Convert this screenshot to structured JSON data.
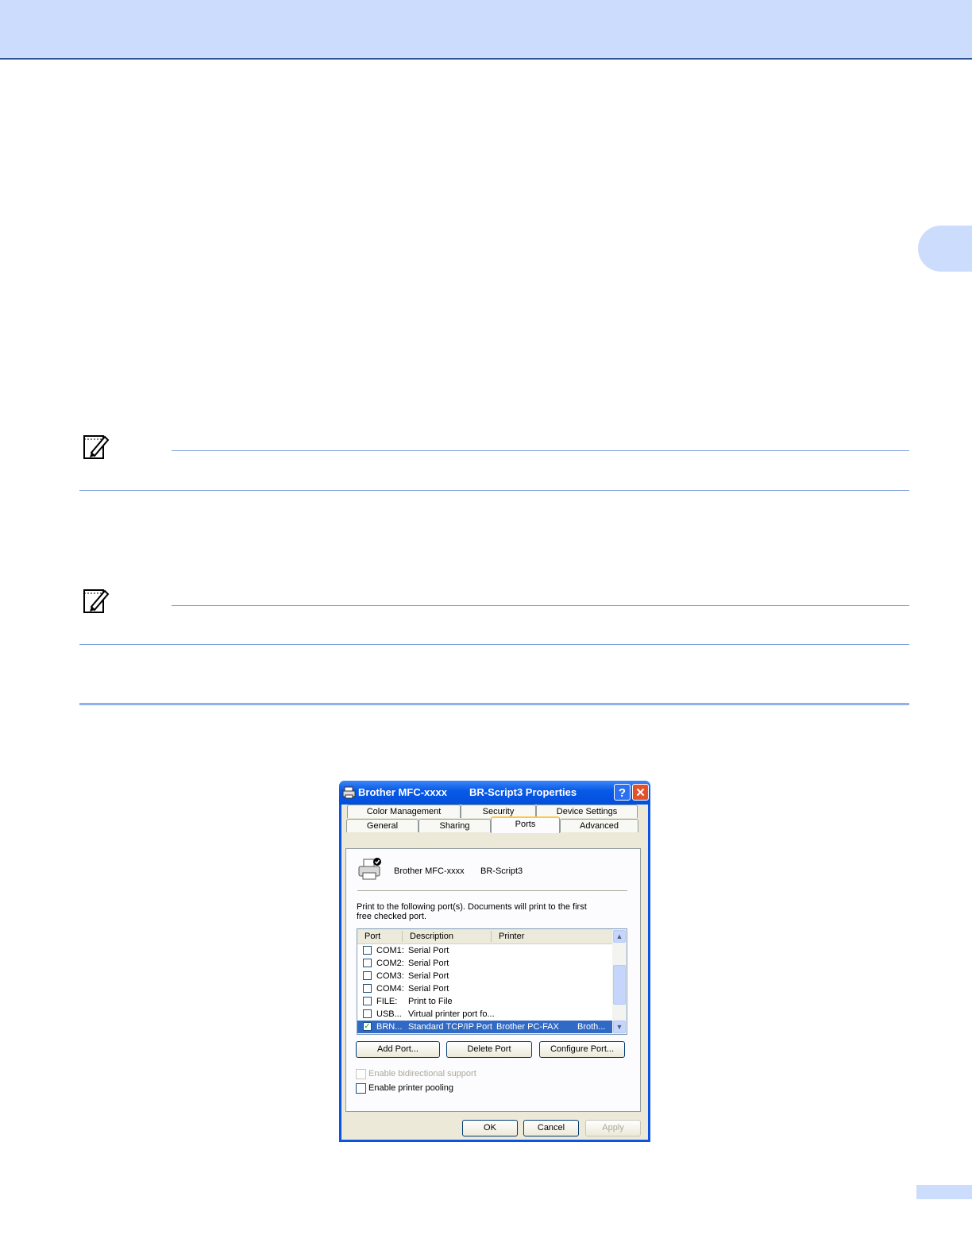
{
  "dialog": {
    "title_left": "Brother MFC-xxxx",
    "title_right": "BR-Script3 Properties",
    "help_symbol": "?",
    "close_symbol": "✕",
    "tabs_row1": [
      "Color Management",
      "Security",
      "Device Settings"
    ],
    "tabs_row2": [
      "General",
      "Sharing",
      "Ports",
      "Advanced"
    ],
    "active_tab": "Ports",
    "printer_name": "Brother MFC-xxxx",
    "printer_driver": "BR-Script3",
    "instruction": "Print to the following port(s). Documents will print to the first free checked port.",
    "columns": [
      "Port",
      "Description",
      "Printer"
    ],
    "ports": [
      {
        "port": "COM1:",
        "description": "Serial Port",
        "printer": "",
        "printer2": "",
        "checked": false
      },
      {
        "port": "COM2:",
        "description": "Serial Port",
        "printer": "",
        "printer2": "",
        "checked": false
      },
      {
        "port": "COM3:",
        "description": "Serial Port",
        "printer": "",
        "printer2": "",
        "checked": false
      },
      {
        "port": "COM4:",
        "description": "Serial Port",
        "printer": "",
        "printer2": "",
        "checked": false
      },
      {
        "port": "FILE:",
        "description": "Print to File",
        "printer": "",
        "printer2": "",
        "checked": false
      },
      {
        "port": "USB...",
        "description": "Virtual printer port fo...",
        "printer": "",
        "printer2": "",
        "checked": false
      },
      {
        "port": "BRN...",
        "description": "Standard TCP/IP Port",
        "printer": "Brother PC-FAX",
        "printer2": "Broth...",
        "checked": true
      }
    ],
    "buttons": {
      "add_port": "Add Port...",
      "delete_port": "Delete Port",
      "configure_port": "Configure Port..."
    },
    "bidirectional_label": "Enable bidirectional support",
    "pooling_label": "Enable printer pooling",
    "footer": {
      "ok": "OK",
      "cancel": "Cancel",
      "apply": "Apply"
    }
  },
  "colors": {
    "band": "#ccdcfc",
    "rule": "#7fa0dc",
    "selection": "#316ac5"
  }
}
